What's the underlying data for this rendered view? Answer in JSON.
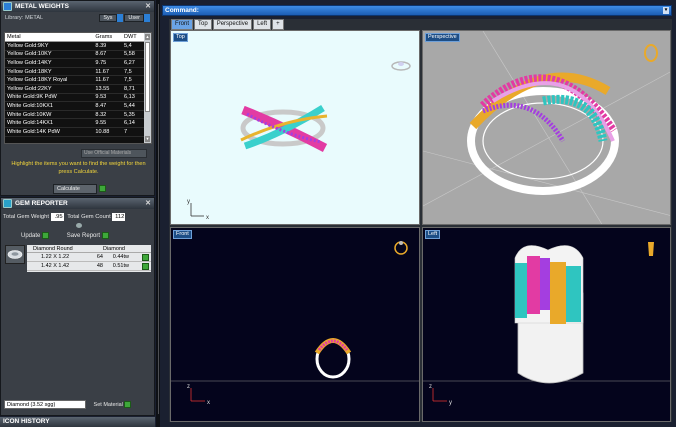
{
  "metal_weights": {
    "title": "METAL WEIGHTS",
    "library_label": "Library:",
    "library_value": "METAL",
    "sys_label": "Sys",
    "user_label": "User",
    "columns": [
      "Metal",
      "Grams",
      "DWT"
    ],
    "rows": [
      [
        "Yellow Gold:9KY",
        "8.39",
        "5,4"
      ],
      [
        "Yellow Gold:10KY",
        "8.67",
        "5,58"
      ],
      [
        "Yellow Gold:14KY",
        "9.75",
        "6,27"
      ],
      [
        "Yellow Gold:18KY",
        "11.67",
        "7,5"
      ],
      [
        "Yellow Gold:18KY Royal",
        "11.67",
        "7,5"
      ],
      [
        "Yellow Gold:22KY",
        "13.55",
        "8,71"
      ],
      [
        "White Gold:9K PdW",
        "9.53",
        "6,13"
      ],
      [
        "White Gold:10KX1",
        "8.47",
        "5,44"
      ],
      [
        "White Gold:10KW",
        "8.32",
        "5,35"
      ],
      [
        "White Gold:14KX1",
        "9.55",
        "6,14"
      ],
      [
        "White Gold:14K PdW",
        "10.88",
        "7"
      ]
    ],
    "official_label": "Use Official Materials",
    "hint": "Highlight the items you want to find the weight for then press Calculate.",
    "calculate_label": "Calculate"
  },
  "gem_reporter": {
    "title": "GEM REPORTER",
    "total_weight_label": "Total Gem Weight",
    "total_weight_value": ".95",
    "total_count_label": "Total Gem Count",
    "total_count_value": "112",
    "update_label": "Update",
    "save_label": "Save Report",
    "header_left": "Diamond Round",
    "header_right": "Diamond",
    "rows": [
      {
        "size": "1.22 X 1.22",
        "count": "64",
        "weight": "0.44tw"
      },
      {
        "size": "1.42 X 1.42",
        "count": "48",
        "weight": "0.51tw"
      }
    ],
    "material_select": "Diamond   (3.52 sgg)",
    "set_material_label": "Set Material"
  },
  "icon_history": {
    "title": "ICON HISTORY"
  },
  "command": {
    "label": "Command:"
  },
  "tabs": [
    "Front",
    "Top",
    "Perspective",
    "Left",
    "+"
  ],
  "viewports": {
    "top": "Top",
    "perspective": "Perspective",
    "front": "Front",
    "left": "Left"
  },
  "axes": {
    "x": "x",
    "y": "y",
    "z": "z"
  },
  "colors": {
    "app_bg": "#1a2030",
    "panel_bg": "#3a3f46",
    "top_view_bg": "#e9fbfd",
    "persp_bg": "#a8a8a8",
    "dark_view_bg": "#04041c",
    "accent_blue": "#2b7fd6",
    "green_button": "#3ea83a",
    "hint_yellow": "#f2d53c"
  }
}
